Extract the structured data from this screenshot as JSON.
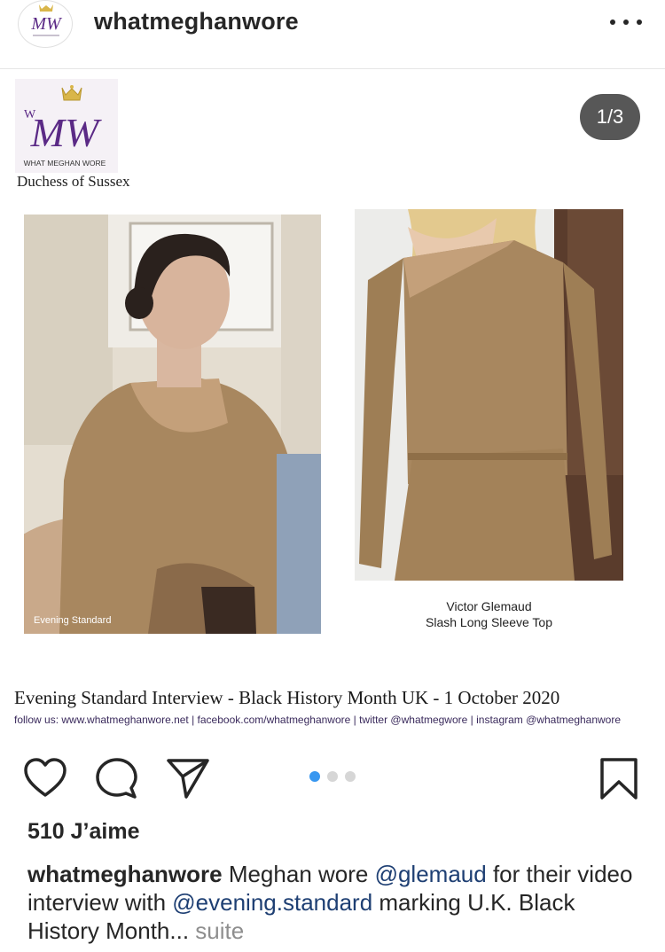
{
  "header": {
    "username": "whatmeghanwore",
    "avatar_logo_text": "MW"
  },
  "post": {
    "counter": "1/3",
    "brand": {
      "logo_letters": "MW",
      "logo_small_w": "W",
      "tagline": "WHAT MEGHAN WORE",
      "subtitle": "Duchess of Sussex"
    },
    "photo_left_credit": "Evening Standard",
    "product": {
      "brand": "Victor Glemaud",
      "name": "Slash Long Sleeve Top"
    },
    "event_title": "Evening Standard Interview - Black History Month UK - 1 October 2020",
    "follow_line": "follow us:  www.whatmeghanwore.net | facebook.com/whatmeghanwore | twitter @whatmegwore | instagram @whatmeghanwore"
  },
  "carousel": {
    "total": 3,
    "active_index": 0
  },
  "actions": {
    "like_icon": "heart-icon",
    "comment_icon": "comment-icon",
    "share_icon": "paper-plane-icon",
    "save_icon": "bookmark-icon"
  },
  "likes": "510 J’aime",
  "caption": {
    "username": "whatmeghanwore",
    "text1": " Meghan wore ",
    "mention1": "@glemaud",
    "text2": " for their video interview with ",
    "mention2": "@evening.standard",
    "text3": " marking U.K. Black History Month...",
    "more": " suite"
  },
  "colors": {
    "accent_blue": "#3897f0",
    "mention": "#1e3f73",
    "logo_purple": "#5b2a86",
    "crown_gold": "#d9b64a",
    "sweater_tan": "#a8875f"
  }
}
